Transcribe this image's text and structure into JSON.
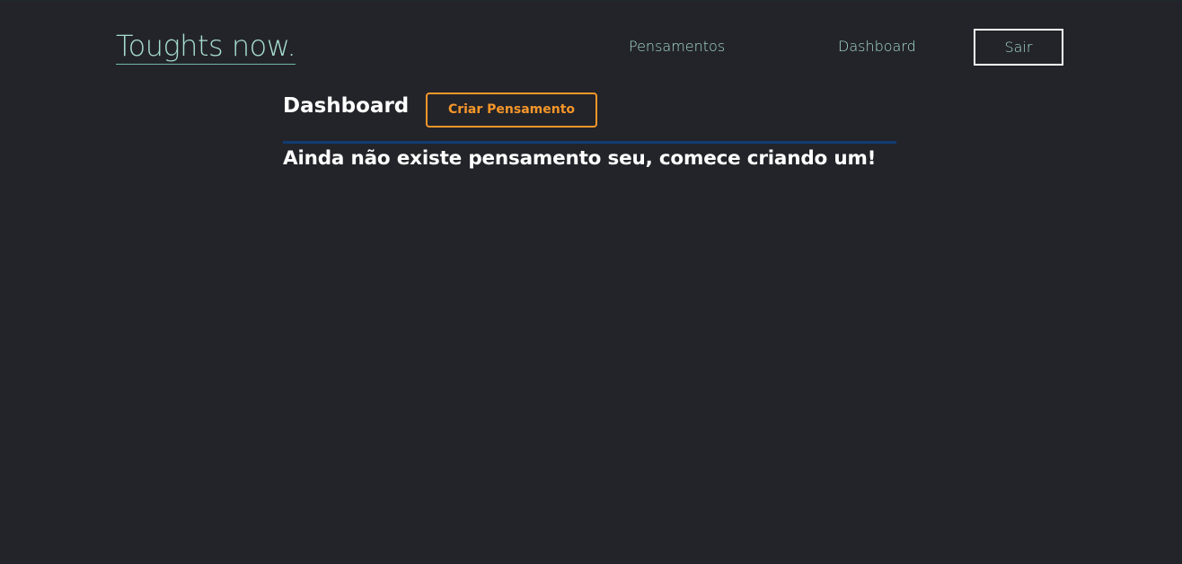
{
  "navbar": {
    "logo": "Toughts now.",
    "links": [
      {
        "label": "Pensamentos"
      },
      {
        "label": "Dashboard"
      }
    ],
    "logout_label": "Sair"
  },
  "dashboard": {
    "title": "Dashboard",
    "create_button_label": "Criar Pensamento",
    "empty_message": "Ainda não existe pensamento seu, comece criando um!"
  },
  "colors": {
    "background": "#232429",
    "nav_text": "#a6dcd2",
    "accent_orange": "#f5962a",
    "divider_blue": "#123c72",
    "heading_text": "#ffffff"
  }
}
